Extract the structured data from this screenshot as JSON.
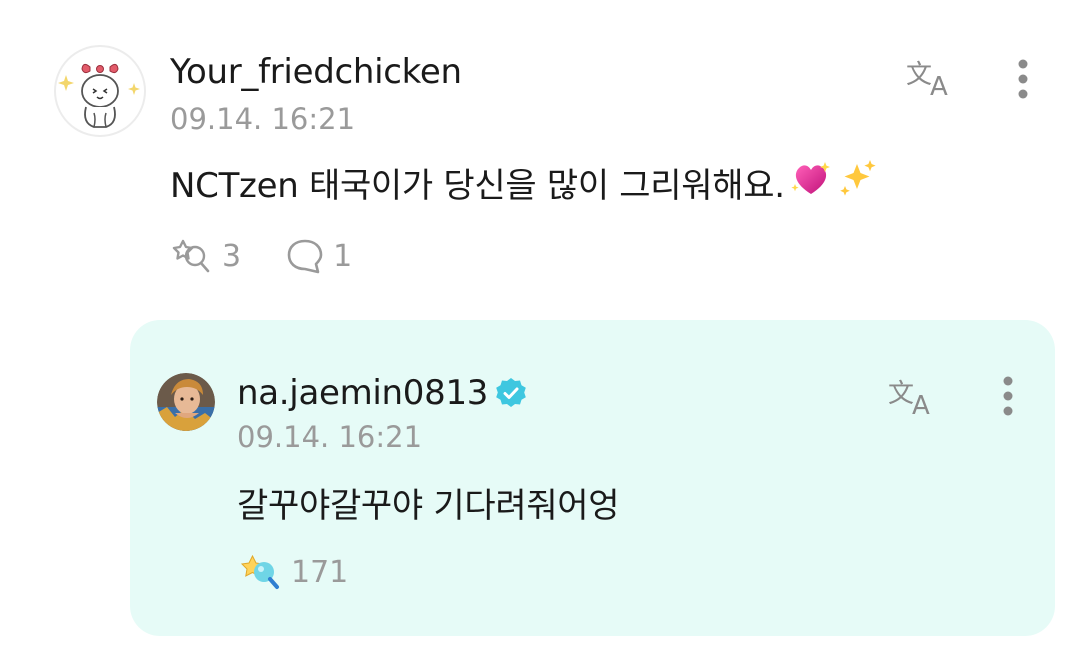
{
  "comment": {
    "username": "Your_friedchicken",
    "timestamp": "09.14. 16:21",
    "text": "NCTzen 태국이가 당신을 많이 그리워해요.",
    "emojis": [
      "💖",
      "✨"
    ],
    "reaction_count": "3",
    "reply_count": "1",
    "icons": {
      "avatar": "bunny-with-bow-avatar",
      "translate": "translate-icon",
      "more": "more-vertical-icon",
      "reaction": "reaction-icon",
      "reply": "comment-bubble-icon"
    }
  },
  "reply": {
    "username": "na.jaemin0813",
    "verified": true,
    "timestamp": "09.14. 16:21",
    "text": "갈꾸야갈꾸야 기다려줘어엉",
    "reaction_count": "171",
    "icons": {
      "avatar": "profile-photo-avatar",
      "verified": "verified-badge-icon",
      "translate": "translate-icon",
      "more": "more-vertical-icon",
      "reaction": "colored-reaction-icon"
    }
  },
  "colors": {
    "reply_background": "#e6fbf7",
    "verified_badge": "#3ec7e0",
    "muted_text": "#9a9a9a",
    "primary_text": "#1a1a1a"
  }
}
